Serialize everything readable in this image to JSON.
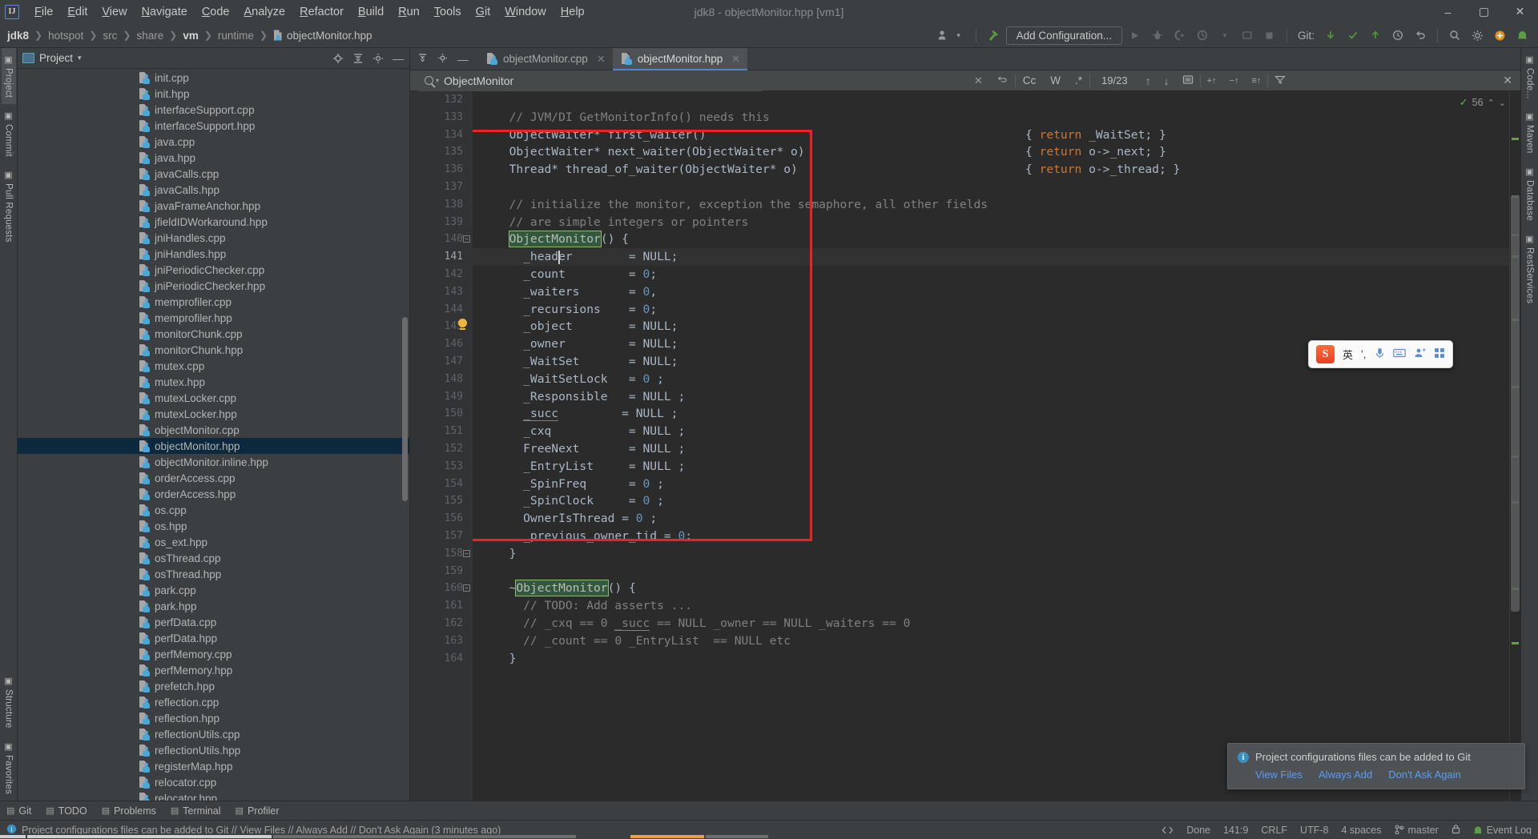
{
  "window": {
    "title": "jdk8 - objectMonitor.hpp [vm1]",
    "minimize": "–",
    "maximize": "▢",
    "close": "✕"
  },
  "menu": {
    "logo": "IJ",
    "items": [
      "File",
      "Edit",
      "View",
      "Navigate",
      "Code",
      "Analyze",
      "Refactor",
      "Build",
      "Run",
      "Tools",
      "Git",
      "Window",
      "Help"
    ]
  },
  "toolbar": {
    "breadcrumb": [
      {
        "label": "jdk8",
        "style": "bold"
      },
      {
        "label": "hotspot",
        "style": "plain"
      },
      {
        "label": "src",
        "style": "plain"
      },
      {
        "label": "share",
        "style": "plain"
      },
      {
        "label": "vm",
        "style": "bold"
      },
      {
        "label": "runtime",
        "style": "plain"
      },
      {
        "label": "objectMonitor.hpp",
        "style": "file"
      }
    ],
    "separator": "❯",
    "run_config_placeholder": "Add Configuration...",
    "git_label": "Git:",
    "icons": {
      "user": "👤",
      "user_caret": "▾",
      "build_hammer": "hammer-icon",
      "run": "▶",
      "debug": "debug-icon",
      "run_coverage": "coverage-icon",
      "profile": "profile-icon",
      "more": "▾",
      "attach": "attach-icon",
      "stop": "■",
      "git_update": "↙",
      "git_commit": "✓",
      "git_push": "↗",
      "history": "⏱",
      "undo": "↩",
      "search_everywhere": "search-icon",
      "settings": "⚙",
      "plus": "⊕",
      "notify": "notification-icon"
    }
  },
  "left_stripe": {
    "top": [
      {
        "label": "Project",
        "icon": "project-icon",
        "active": true
      },
      {
        "label": "Commit",
        "icon": "commit-icon",
        "active": false
      },
      {
        "label": "Pull Requests",
        "icon": "pull-request-icon",
        "active": false
      }
    ],
    "bottom": [
      {
        "label": "Structure",
        "icon": "structure-icon"
      },
      {
        "label": "Favorites",
        "icon": "star-icon"
      }
    ]
  },
  "right_stripe": {
    "items": [
      {
        "label": "Code...",
        "icon": "code-icon"
      },
      {
        "label": "Maven",
        "icon": "maven-icon"
      },
      {
        "label": "Database",
        "icon": "database-icon"
      },
      {
        "label": "RestServices",
        "icon": "rest-icon"
      }
    ]
  },
  "project_panel": {
    "title": "Project",
    "caret": "▾",
    "icons": {
      "locate": "⊕",
      "collapse": "⇱",
      "settings": "⚙",
      "hide": "—"
    },
    "files": [
      {
        "name": "init.cpp"
      },
      {
        "name": "init.hpp"
      },
      {
        "name": "interfaceSupport.cpp"
      },
      {
        "name": "interfaceSupport.hpp"
      },
      {
        "name": "java.cpp"
      },
      {
        "name": "java.hpp"
      },
      {
        "name": "javaCalls.cpp"
      },
      {
        "name": "javaCalls.hpp"
      },
      {
        "name": "javaFrameAnchor.hpp"
      },
      {
        "name": "jfieldIDWorkaround.hpp"
      },
      {
        "name": "jniHandles.cpp"
      },
      {
        "name": "jniHandles.hpp"
      },
      {
        "name": "jniPeriodicChecker.cpp"
      },
      {
        "name": "jniPeriodicChecker.hpp"
      },
      {
        "name": "memprofiler.cpp"
      },
      {
        "name": "memprofiler.hpp"
      },
      {
        "name": "monitorChunk.cpp"
      },
      {
        "name": "monitorChunk.hpp"
      },
      {
        "name": "mutex.cpp"
      },
      {
        "name": "mutex.hpp"
      },
      {
        "name": "mutexLocker.cpp"
      },
      {
        "name": "mutexLocker.hpp"
      },
      {
        "name": "objectMonitor.cpp"
      },
      {
        "name": "objectMonitor.hpp",
        "selected": true
      },
      {
        "name": "objectMonitor.inline.hpp"
      },
      {
        "name": "orderAccess.cpp"
      },
      {
        "name": "orderAccess.hpp"
      },
      {
        "name": "os.cpp"
      },
      {
        "name": "os.hpp"
      },
      {
        "name": "os_ext.hpp"
      },
      {
        "name": "osThread.cpp"
      },
      {
        "name": "osThread.hpp"
      },
      {
        "name": "park.cpp"
      },
      {
        "name": "park.hpp"
      },
      {
        "name": "perfData.cpp"
      },
      {
        "name": "perfData.hpp"
      },
      {
        "name": "perfMemory.cpp"
      },
      {
        "name": "perfMemory.hpp"
      },
      {
        "name": "prefetch.hpp"
      },
      {
        "name": "reflection.cpp"
      },
      {
        "name": "reflection.hpp"
      },
      {
        "name": "reflectionUtils.cpp"
      },
      {
        "name": "reflectionUtils.hpp"
      },
      {
        "name": "registerMap.hpp"
      },
      {
        "name": "relocator.cpp"
      },
      {
        "name": "relocator.hpp"
      }
    ]
  },
  "editor": {
    "tabs": [
      {
        "label": "objectMonitor.cpp",
        "active": false,
        "close": "✕"
      },
      {
        "label": "objectMonitor.hpp",
        "active": true,
        "close": "✕"
      }
    ],
    "tab_controls": {
      "sort": "⇅",
      "settings": "⚙",
      "hide": "—"
    },
    "find": {
      "value": "ObjectMonitor",
      "placeholder": "Search",
      "clear": "✕",
      "history": "⏎",
      "case_sensitive": "Cc",
      "words": "W",
      "regex": ".*",
      "counter": "19/23",
      "prev": "↑",
      "next": "↓",
      "select_all": "⬓",
      "add_multi": "+↑",
      "remove_multi": "−↑",
      "select_occurrences": "≡↑",
      "filter": "filter-icon",
      "close": "✕"
    },
    "inspection": {
      "count": "56",
      "check": "✓",
      "up": "⌃",
      "down": "⌄"
    },
    "first_line": 132,
    "current_line": 141,
    "lines": [
      {
        "n": 132,
        "tokens": []
      },
      {
        "n": 133,
        "tokens": [
          {
            "t": "  // JVM/DI GetMonitorInfo() needs this",
            "c": "cmt"
          }
        ]
      },
      {
        "n": 134,
        "tokens": [
          {
            "t": "  ObjectWaiter* first_waiter()",
            "c": "id"
          }
        ],
        "rhs": [
          {
            "t": "{ ",
            "c": "punct"
          },
          {
            "t": "return",
            "c": "kw"
          },
          {
            "t": " _WaitSet; }",
            "c": "id"
          }
        ]
      },
      {
        "n": 135,
        "tokens": [
          {
            "t": "  ObjectWaiter* next_waiter(ObjectWaiter* o)",
            "c": "id"
          }
        ],
        "rhs": [
          {
            "t": "{ ",
            "c": "punct"
          },
          {
            "t": "return",
            "c": "kw"
          },
          {
            "t": " o->_next; }",
            "c": "id"
          }
        ]
      },
      {
        "n": 136,
        "tokens": [
          {
            "t": "  Thread* thread_of_waiter(ObjectWaiter* o)",
            "c": "id"
          }
        ],
        "rhs": [
          {
            "t": "{ ",
            "c": "punct"
          },
          {
            "t": "return",
            "c": "kw"
          },
          {
            "t": " o->_thread; }",
            "c": "id"
          }
        ]
      },
      {
        "n": 137,
        "tokens": []
      },
      {
        "n": 138,
        "tokens": [
          {
            "t": "  // initialize the monitor, exception the semaphore, all other fields",
            "c": "cmt"
          }
        ]
      },
      {
        "n": 139,
        "tokens": [
          {
            "t": "  // are simple integers or pointers",
            "c": "cmt"
          }
        ]
      },
      {
        "n": 140,
        "tokens": [
          {
            "t": "  ",
            "c": "id"
          },
          {
            "t": "ObjectMonitor",
            "c": "sel"
          },
          {
            "t": "() {",
            "c": "id"
          }
        ],
        "fold": "−"
      },
      {
        "n": 141,
        "tokens": [
          {
            "t": "    _header        = ",
            "c": "id"
          },
          {
            "t": "NULL;",
            "c": "id"
          }
        ],
        "highlight": true,
        "bulb": true,
        "caret_col": 9
      },
      {
        "n": 142,
        "tokens": [
          {
            "t": "    _count         = ",
            "c": "id"
          },
          {
            "t": "0",
            "c": "num"
          },
          {
            "t": ";",
            "c": "id"
          }
        ]
      },
      {
        "n": 143,
        "tokens": [
          {
            "t": "    _waiters       = ",
            "c": "id"
          },
          {
            "t": "0",
            "c": "num"
          },
          {
            "t": ",",
            "c": "id"
          }
        ]
      },
      {
        "n": 144,
        "tokens": [
          {
            "t": "    _recursions    = ",
            "c": "id"
          },
          {
            "t": "0",
            "c": "num"
          },
          {
            "t": ";",
            "c": "id"
          }
        ]
      },
      {
        "n": 145,
        "tokens": [
          {
            "t": "    _object        = NULL;",
            "c": "id"
          }
        ]
      },
      {
        "n": 146,
        "tokens": [
          {
            "t": "    _owner         = NULL;",
            "c": "id"
          }
        ]
      },
      {
        "n": 147,
        "tokens": [
          {
            "t": "    _WaitSet       = NULL;",
            "c": "id"
          }
        ]
      },
      {
        "n": 148,
        "tokens": [
          {
            "t": "    _WaitSetLock   = ",
            "c": "id"
          },
          {
            "t": "0",
            "c": "num"
          },
          {
            "t": " ;",
            "c": "id"
          }
        ]
      },
      {
        "n": 149,
        "tokens": [
          {
            "t": "    _Responsible   = NULL ;",
            "c": "id"
          }
        ]
      },
      {
        "n": 150,
        "tokens": [
          {
            "t": "    ",
            "c": "id"
          },
          {
            "t": "_succ",
            "c": "uid"
          },
          {
            "t": "         = NULL ;",
            "c": "id"
          }
        ]
      },
      {
        "n": 151,
        "tokens": [
          {
            "t": "    _cxq           = NULL ;",
            "c": "id"
          }
        ]
      },
      {
        "n": 152,
        "tokens": [
          {
            "t": "    FreeNext       = NULL ;",
            "c": "id"
          }
        ]
      },
      {
        "n": 153,
        "tokens": [
          {
            "t": "    _EntryList     = NULL ;",
            "c": "id"
          }
        ]
      },
      {
        "n": 154,
        "tokens": [
          {
            "t": "    _SpinFreq      = ",
            "c": "id"
          },
          {
            "t": "0",
            "c": "num"
          },
          {
            "t": " ;",
            "c": "id"
          }
        ]
      },
      {
        "n": 155,
        "tokens": [
          {
            "t": "    _SpinClock     = ",
            "c": "id"
          },
          {
            "t": "0",
            "c": "num"
          },
          {
            "t": " ;",
            "c": "id"
          }
        ]
      },
      {
        "n": 156,
        "tokens": [
          {
            "t": "    OwnerIsThread = ",
            "c": "id"
          },
          {
            "t": "0",
            "c": "num"
          },
          {
            "t": " ;",
            "c": "id"
          }
        ]
      },
      {
        "n": 157,
        "tokens": [
          {
            "t": "    _previous_owner_tid = ",
            "c": "id"
          },
          {
            "t": "0",
            "c": "num"
          },
          {
            "t": ";",
            "c": "id"
          }
        ]
      },
      {
        "n": 158,
        "tokens": [
          {
            "t": "  }",
            "c": "id"
          }
        ],
        "fold": "−"
      },
      {
        "n": 159,
        "tokens": []
      },
      {
        "n": 160,
        "tokens": [
          {
            "t": "  ~",
            "c": "id"
          },
          {
            "t": "ObjectMonitor",
            "c": "sel"
          },
          {
            "t": "() {",
            "c": "id"
          }
        ],
        "fold": "−"
      },
      {
        "n": 161,
        "tokens": [
          {
            "t": "    // TODO: Add asserts ...",
            "c": "cmt"
          }
        ]
      },
      {
        "n": 162,
        "tokens": [
          {
            "t": "    // _cxq == 0 ",
            "c": "cmt"
          },
          {
            "t": "_succ",
            "c": "ucmt"
          },
          {
            "t": " == NULL _owner == NULL _waiters == 0",
            "c": "cmt"
          }
        ]
      },
      {
        "n": 163,
        "tokens": [
          {
            "t": "    // _count == 0 _EntryList  == NULL etc",
            "c": "cmt"
          }
        ]
      },
      {
        "n": 164,
        "tokens": [
          {
            "t": "  }",
            "c": "id"
          }
        ]
      }
    ],
    "redbox_label": "code-annotation-rectangle"
  },
  "ime": {
    "logo": "S",
    "mode": "英",
    "comma": "ʼ,",
    "mic": "mic-icon",
    "keyboard": "keyboard-icon",
    "user": "user-icon",
    "menu": "menu-icon"
  },
  "notification": {
    "icon": "i",
    "message": "Project configurations files can be added to Git",
    "links": [
      "View Files",
      "Always Add",
      "Don't Ask Again"
    ]
  },
  "bottom_stripe": {
    "items": [
      {
        "label": "Git",
        "icon": "git-icon"
      },
      {
        "label": "TODO",
        "icon": "todo-icon"
      },
      {
        "label": "Problems",
        "icon": "problems-icon"
      },
      {
        "label": "Terminal",
        "icon": "terminal-icon"
      },
      {
        "label": "Profiler",
        "icon": "profiler-icon"
      }
    ]
  },
  "statusbar": {
    "message": "Project configurations files can be added to Git // View Files // Always Add // Don't Ask Again (3 minutes ago)",
    "done": "Done",
    "position": "141:9",
    "line_sep": "CRLF",
    "encoding": "UTF-8",
    "indent": "4 spaces",
    "branch": "master",
    "lock": "lock-icon",
    "event_log": "Event Log",
    "inspection_icon": "inspection-icon"
  }
}
